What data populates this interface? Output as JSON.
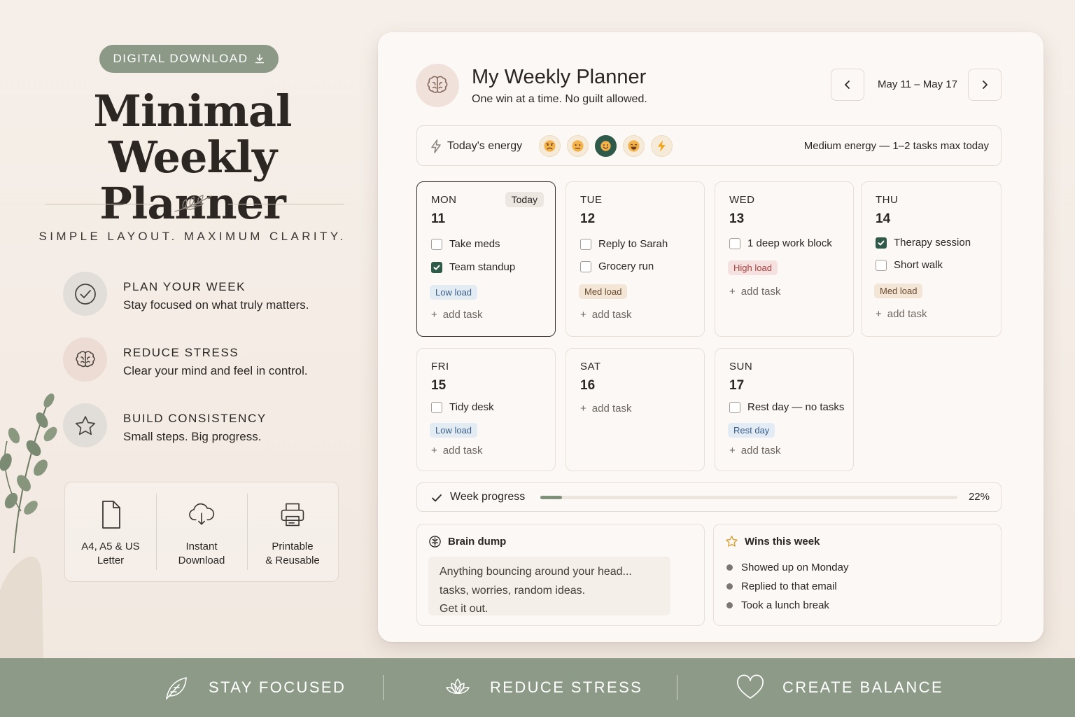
{
  "promo": {
    "badge": "DIGITAL DOWNLOAD",
    "headline_line1": "Minimal",
    "headline_line2": "Weekly Planner",
    "tagline": "SIMPLE LAYOUT. MAXIMUM CLARITY.",
    "features": [
      {
        "icon": "check-circle-icon",
        "title": "PLAN YOUR WEEK",
        "desc": "Stay focused on what truly matters."
      },
      {
        "icon": "brain-icon",
        "title": "REDUCE STRESS",
        "desc": "Clear your mind and feel in control."
      },
      {
        "icon": "star-icon",
        "title": "BUILD CONSISTENCY",
        "desc": "Small steps. Big progress."
      }
    ],
    "formats": [
      {
        "icon": "document-icon",
        "label": "A4, A5 & US\nLetter"
      },
      {
        "icon": "cloud-download-icon",
        "label": "Instant\nDownload"
      },
      {
        "icon": "printer-icon",
        "label": "Printable\n& Reusable"
      }
    ]
  },
  "planner": {
    "title": "My Weekly Planner",
    "subtitle": "One win at a time. No guilt allowed.",
    "date_range": "May 11 – May 17",
    "energy": {
      "label": "Today's energy",
      "selected_index": 2,
      "note": "Medium energy — 1–2 tasks max today"
    },
    "add_task_label": "add task",
    "days": [
      {
        "name": "MON",
        "date": "11",
        "badge": "Today",
        "tasks": [
          {
            "text": "Take meds",
            "done": false
          },
          {
            "text": "Team standup",
            "done": true
          }
        ],
        "load": "Low load",
        "load_type": "low"
      },
      {
        "name": "TUE",
        "date": "12",
        "tasks": [
          {
            "text": "Reply to Sarah",
            "done": false
          },
          {
            "text": "Grocery run",
            "done": false
          }
        ],
        "load": "Med load",
        "load_type": "med"
      },
      {
        "name": "WED",
        "date": "13",
        "tasks": [
          {
            "text": "1 deep work block",
            "done": false
          }
        ],
        "load": "High load",
        "load_type": "high"
      },
      {
        "name": "THU",
        "date": "14",
        "tasks": [
          {
            "text": "Therapy session",
            "done": true
          },
          {
            "text": "Short walk",
            "done": false
          }
        ],
        "load": "Med load",
        "load_type": "med"
      },
      {
        "name": "FRI",
        "date": "15",
        "tasks": [
          {
            "text": "Tidy desk",
            "done": false
          }
        ],
        "load": "Low load",
        "load_type": "low"
      },
      {
        "name": "SAT",
        "date": "16",
        "tasks": []
      },
      {
        "name": "SUN",
        "date": "17",
        "tasks": [
          {
            "text": "Rest day — no tasks",
            "done": false
          }
        ],
        "load": "Rest day",
        "load_type": "rest"
      }
    ],
    "progress": {
      "label": "Week progress",
      "value": 22,
      "display": "22%"
    },
    "brain_dump": {
      "title": "Brain dump",
      "lines": [
        "Anything bouncing around your head...",
        "tasks, worries, random ideas.",
        "Get it out."
      ]
    },
    "wins": {
      "title": "Wins this week",
      "items": [
        "Showed up on Monday",
        "Replied to that email",
        "Took a lunch break"
      ]
    }
  },
  "footer": {
    "items": [
      {
        "icon": "leaf-icon",
        "label": "STAY FOCUSED"
      },
      {
        "icon": "lotus-icon",
        "label": "REDUCE STRESS"
      },
      {
        "icon": "heart-icon",
        "label": "CREATE BALANCE"
      }
    ]
  },
  "colors": {
    "sage": "#8d9a87",
    "deep_green": "#2f5a4a",
    "card": "#fbf8f5",
    "background": "#f4ece5"
  }
}
